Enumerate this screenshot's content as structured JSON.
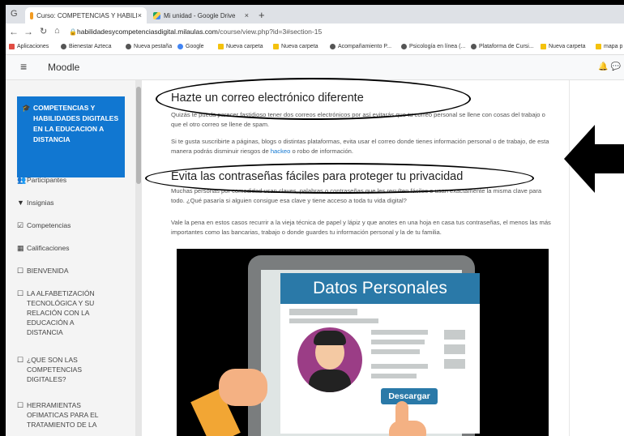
{
  "browser": {
    "tabs": [
      {
        "title": "Curso: COMPETENCIAS Y HABILI",
        "active": true
      },
      {
        "title": "Mi unidad - Google Drive",
        "active": false
      }
    ],
    "url_host": "habilidadesycompetenciasdigital.milaulas.com",
    "url_path": "/course/view.php?id=3#section-15",
    "bookmarks": [
      "Aplicaciones",
      "Bienestar Azteca",
      "Nueva pestaña",
      "Google",
      "Nueva carpeta",
      "Nueva carpeta",
      "Acompañamiento P...",
      "Psicología en línea (...",
      "Plataforma de Cursi...",
      "Nueva carpeta",
      "mapa p"
    ]
  },
  "moodle": {
    "brand": "Moodle"
  },
  "sidebar": {
    "active": "COMPETENCIAS Y HABILIDADES DIGITALES EN LA EDUCACION A DISTANCIA",
    "items": [
      {
        "label": "Participantes",
        "icon": "users-icon"
      },
      {
        "label": "Insignias",
        "icon": "badge-icon"
      },
      {
        "label": "Competencias",
        "icon": "checkbox-icon"
      },
      {
        "label": "Calificaciones",
        "icon": "grid-icon"
      },
      {
        "label": "BIENVENIDA",
        "icon": "folder-icon"
      },
      {
        "label": "LA ALFABETIZACIÓN TECNOLÓGICA Y SU RELACIÓN CON LA EDUCACIÓN A DISTANCIA",
        "icon": "folder-icon"
      },
      {
        "label": "¿QUE SON LAS COMPETENCIAS DIGITALES?",
        "icon": "folder-icon"
      },
      {
        "label": "HERRAMIENTAS OFIMATICAS PARA EL TRATAMIENTO DE LA",
        "icon": "folder-icon"
      }
    ]
  },
  "content": {
    "heading1": "Hazte un correo electrónico diferente",
    "para1": "Quizás te pueda parecer fastidioso tener dos correos electrónicos por así evitarás que tu correo personal se llene con cosas del trabajo o que el otro correo se llene de spam.",
    "para2_before": "Si te gusta suscribirte a páginas, blogs o distintas plataformas, evita usar el correo donde tienes información personal o de trabajo, de esta manera podrás disminuir riesgos de ",
    "para2_link": "hackeo",
    "para2_after": " o robo de información.",
    "heading2": "Evita las contraseñas fáciles para proteger tu privacidad",
    "para3": "Muchas personas por comodidad usan claves, palabras o contraseñas que les resulten fáciles o usan exactamente la misma clave para todo. ¿Qué pasaría si alguien consigue esa clave y tiene acceso a toda tu vida digital?",
    "para4": "Vale la pena en estos casos recurrir a la vieja técnica de papel y lápiz y que anotes en una hoja en casa tus contraseñas, el menos las más importantes como las bancarias, trabajo o donde guardes tu información personal y la de tu familia.",
    "image": {
      "title": "Datos Personales",
      "button": "Descargar"
    }
  },
  "colors": {
    "moodle_blue": "#1177d1",
    "image_blue": "#2a79a8"
  }
}
